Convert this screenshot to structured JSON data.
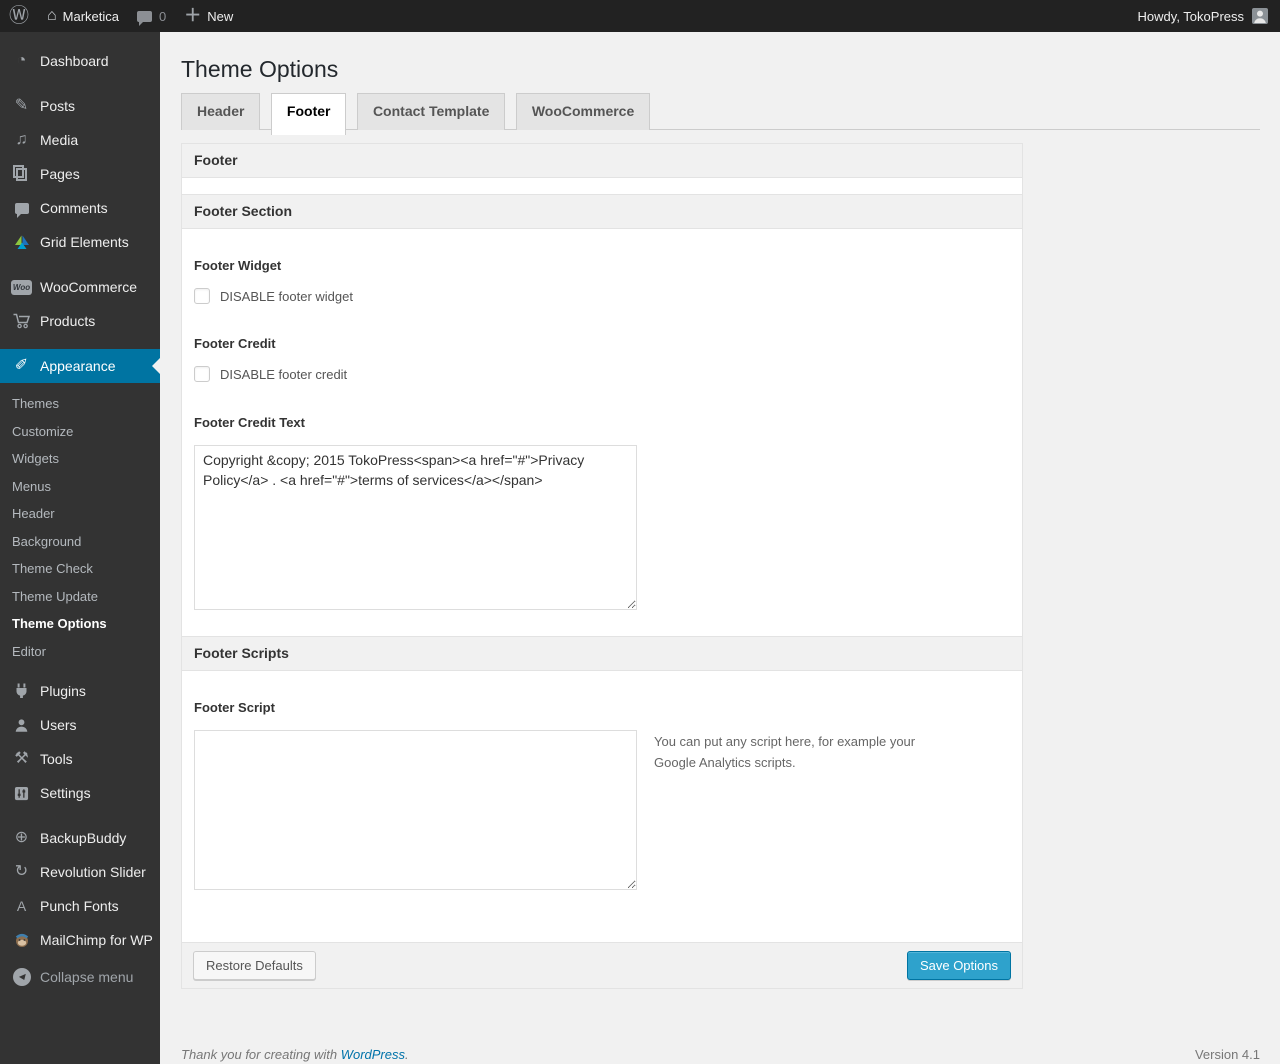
{
  "admin_bar": {
    "site_name": "Marketica",
    "comment_count": "0",
    "new_label": "New",
    "howdy": "Howdy, TokoPress"
  },
  "sidebar": {
    "items": [
      "Dashboard",
      "Posts",
      "Media",
      "Pages",
      "Comments",
      "Grid Elements",
      "WooCommerce",
      "Products",
      "Appearance",
      "Plugins",
      "Users",
      "Tools",
      "Settings",
      "BackupBuddy",
      "Revolution Slider",
      "Punch Fonts",
      "MailChimp for WP"
    ],
    "icons": {
      "dashboard": "◔",
      "posts": "✎",
      "media": "♫",
      "appearance": "✐",
      "tools": "⚒",
      "settings": "⚙",
      "backupbuddy": "⊕",
      "revolution_slider": "↻",
      "punch_fonts": "A",
      "collapse_arrow": "◀",
      "home": "⌂",
      "wp_logo": "Ⓦ",
      "plus": "＋"
    },
    "appearance_submenu": [
      "Themes",
      "Customize",
      "Widgets",
      "Menus",
      "Header",
      "Background",
      "Theme Check",
      "Theme Update",
      "Theme Options",
      "Editor"
    ],
    "collapse_label": "Collapse menu"
  },
  "main": {
    "page_title": "Theme Options",
    "tabs": [
      "Header",
      "Footer",
      "Contact Template",
      "WooCommerce"
    ],
    "panel": {
      "group_title": "Footer",
      "section1_title": "Footer Section",
      "footer_widget": {
        "label": "Footer Widget",
        "checkbox_label": "DISABLE footer widget",
        "checked": false
      },
      "footer_credit": {
        "label": "Footer Credit",
        "checkbox_label": "DISABLE footer credit",
        "checked": false
      },
      "footer_credit_text": {
        "label": "Footer Credit Text",
        "value": "Copyright &copy; 2015 TokoPress<span><a href=\"#\">Privacy Policy</a> . <a href=\"#\">terms of services</a></span>"
      },
      "section2_title": "Footer Scripts",
      "footer_script": {
        "label": "Footer Script",
        "value": "",
        "help": "You can put any script here, for example your Google Analytics scripts."
      },
      "actions": {
        "restore": "Restore Defaults",
        "save": "Save Options"
      }
    }
  },
  "footer": {
    "thanks_prefix": "Thank you for creating with ",
    "wordpress_link": "WordPress",
    "thanks_suffix": ".",
    "version": "Version 4.1"
  },
  "colors": {
    "accent": "#0074a2",
    "button_primary": "#2ea2cc",
    "link": "#0073aa",
    "adminbar_bg": "#222222",
    "sidebar_bg": "#333333"
  }
}
